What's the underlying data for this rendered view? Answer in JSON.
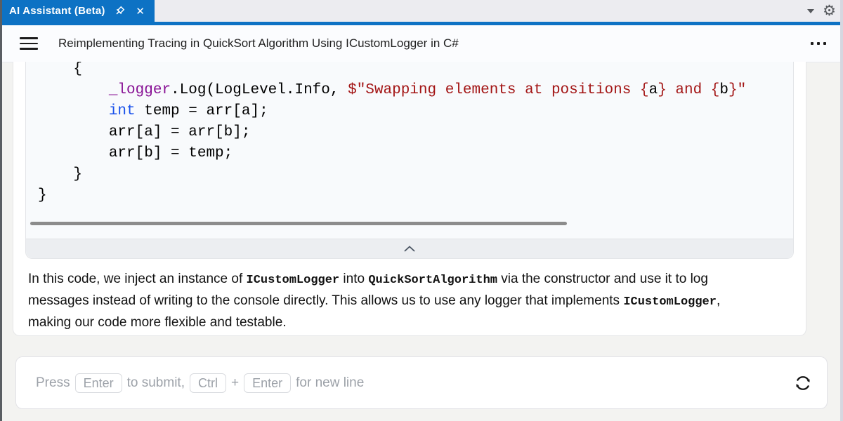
{
  "window": {
    "tab_title": "AI Assistant (Beta)",
    "accent_blue": "#0D72C4",
    "close_glyph": "✕",
    "gear_glyph": "⚙"
  },
  "header": {
    "title": "Reimplementing Tracing in QuickSort Algorithm Using ICustomLogger in C#"
  },
  "code_block": {
    "language": "csharp",
    "colors": {
      "plain": "#000000",
      "field": "#871094",
      "keyword": "#1750EB",
      "string": "#A31515"
    },
    "lines": [
      [
        {
          "t": "    {",
          "c": "plain"
        }
      ],
      [
        {
          "t": "        ",
          "c": "plain"
        },
        {
          "t": "_logger",
          "c": "field"
        },
        {
          "t": ".Log(LogLevel.Info, ",
          "c": "plain"
        },
        {
          "t": "$\"Swapping elements at positions {",
          "c": "string"
        },
        {
          "t": "a",
          "c": "plain"
        },
        {
          "t": "} and {",
          "c": "string"
        },
        {
          "t": "b",
          "c": "plain"
        },
        {
          "t": "}\"",
          "c": "string"
        }
      ],
      [
        {
          "t": "        ",
          "c": "plain"
        },
        {
          "t": "int",
          "c": "keyword"
        },
        {
          "t": " temp = arr[a];",
          "c": "plain"
        }
      ],
      [
        {
          "t": "        arr[a] = arr[b];",
          "c": "plain"
        }
      ],
      [
        {
          "t": "        arr[b] = temp;",
          "c": "plain"
        }
      ],
      [
        {
          "t": "    }",
          "c": "plain"
        }
      ],
      [
        {
          "t": "}",
          "c": "plain"
        }
      ]
    ]
  },
  "response": {
    "paragraph_lines": [
      [
        {
          "t": "In this code, we inject an instance of "
        },
        {
          "t": "ICustomLogger",
          "code": true
        },
        {
          "t": " into "
        },
        {
          "t": "QuickSortAlgorithm",
          "code": true
        },
        {
          "t": " via the constructor and use it to log"
        }
      ],
      [
        {
          "t": "messages instead of writing to the console directly. This allows us to use any logger that implements "
        },
        {
          "t": "ICustomLogger",
          "code": true
        },
        {
          "t": ","
        }
      ],
      [
        {
          "t": "making our code more flexible and testable."
        }
      ]
    ]
  },
  "input": {
    "placeholder_segments": [
      {
        "t": "Press "
      },
      {
        "key": "Enter"
      },
      {
        "t": " to submit, "
      },
      {
        "key": "Ctrl"
      },
      {
        "t": " + "
      },
      {
        "key": "Enter"
      },
      {
        "t": " for new line"
      }
    ]
  }
}
